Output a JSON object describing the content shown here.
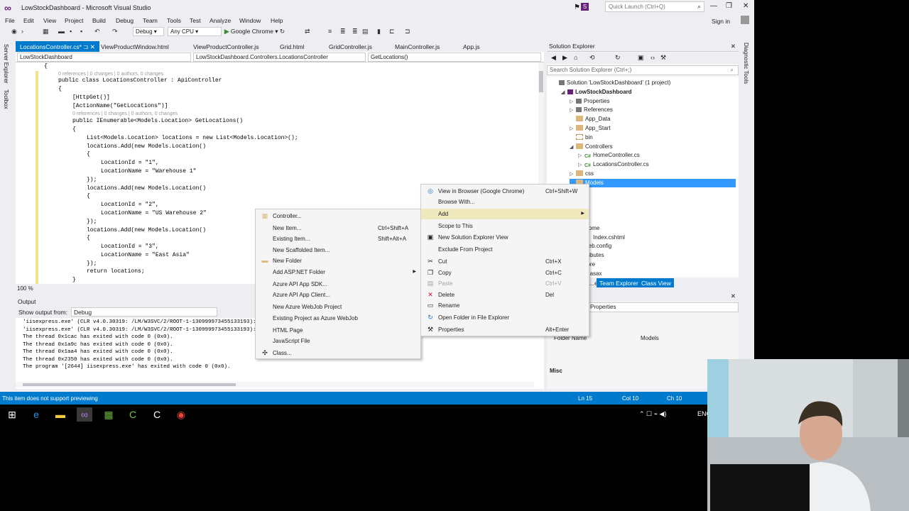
{
  "window": {
    "title": "LowStockDashboard - Microsoft Visual Studio",
    "quick_launch_placeholder": "Quick Launch (Ctrl+Q)",
    "sign_in": "Sign in"
  },
  "menus": [
    "File",
    "Edit",
    "View",
    "Project",
    "Build",
    "Debug",
    "Team",
    "Tools",
    "Test",
    "Analyze",
    "Window",
    "Help"
  ],
  "toolbar": {
    "config": "Debug",
    "platform": "Any CPU",
    "run_target": "Google Chrome"
  },
  "left_tabs": [
    "Server Explorer",
    "Toolbox"
  ],
  "right_tabs": [
    "Diagnostic Tools"
  ],
  "doc_tabs": [
    "LocationsController.cs*",
    "ViewProductWindow.html",
    "ViewProductController.js",
    "Grid.html",
    "GridController.js",
    "MainController.js",
    "App.js"
  ],
  "nav_bar": {
    "project": "LowStockDashboard",
    "class": "LowStockDashboard.Controllers.LocationsController",
    "member": "GetLocations()"
  },
  "code_lines": [
    {
      "indent": 0,
      "text": "{",
      "kind": "code"
    },
    {
      "indent": 1,
      "text": "0 references | 0 changes | 0 authors, 0 changes",
      "kind": "lens"
    },
    {
      "indent": 1,
      "text": "public class LocationsController : ApiController",
      "kind": "code"
    },
    {
      "indent": 1,
      "text": "{",
      "kind": "code"
    },
    {
      "indent": 2,
      "text": "[HttpGet()]",
      "kind": "code"
    },
    {
      "indent": 2,
      "text": "[ActionName(\"GetLocations\")]",
      "kind": "code"
    },
    {
      "indent": 2,
      "text": "0 references | 0 changes | 0 authors, 0 changes",
      "kind": "lens"
    },
    {
      "indent": 2,
      "text": "public IEnumerable<Models.Location> GetLocations()",
      "kind": "code"
    },
    {
      "indent": 2,
      "text": "{",
      "kind": "code"
    },
    {
      "indent": 3,
      "text": "List<Models.Location> locations = new List<Models.Location>();",
      "kind": "code"
    },
    {
      "indent": 3,
      "text": "locations.Add(new Models.Location()",
      "kind": "code"
    },
    {
      "indent": 3,
      "text": "{",
      "kind": "code"
    },
    {
      "indent": 4,
      "text": "LocationId = \"1\",",
      "kind": "code"
    },
    {
      "indent": 4,
      "text": "LocationName = \"Warehouse 1\"",
      "kind": "code"
    },
    {
      "indent": 3,
      "text": "});",
      "kind": "code"
    },
    {
      "indent": 3,
      "text": "locations.Add(new Models.Location()",
      "kind": "code"
    },
    {
      "indent": 3,
      "text": "{",
      "kind": "code"
    },
    {
      "indent": 4,
      "text": "LocationId = \"2\",",
      "kind": "code"
    },
    {
      "indent": 4,
      "text": "LocationName = \"US Warehouse 2\"",
      "kind": "code"
    },
    {
      "indent": 3,
      "text": "});",
      "kind": "code"
    },
    {
      "indent": 3,
      "text": "locations.Add(new Models.Location()",
      "kind": "code"
    },
    {
      "indent": 3,
      "text": "{",
      "kind": "code"
    },
    {
      "indent": 4,
      "text": "LocationId = \"3\",",
      "kind": "code"
    },
    {
      "indent": 4,
      "text": "LocationName = \"East Asia\"",
      "kind": "code"
    },
    {
      "indent": 3,
      "text": "});",
      "kind": "code"
    },
    {
      "indent": 3,
      "text": "return locations;",
      "kind": "code"
    },
    {
      "indent": 2,
      "text": "}",
      "kind": "code"
    }
  ],
  "zoom": "100 %",
  "output": {
    "title": "Output",
    "show_from_label": "Show output from:",
    "source": "Debug",
    "lines": [
      "'iisexpress.exe' (CLR v4.0.30319: /LM/W3SVC/2/ROOT-1-130999973455133193):",
      "'iisexpress.exe' (CLR v4.0.30319: /LM/W3SVC/2/ROOT-1-130999973455133193):",
      "The thread 0x1cac has exited with code 0 (0x0).",
      "The thread 0x1a9c has exited with code 0 (0x0).",
      "The thread 0x1aa4 has exited with code 0 (0x0).",
      "The thread 0x2350 has exited with code 0 (0x0).",
      "The program '[2644] iisexpress.exe' has exited with code 0 (0x0)."
    ]
  },
  "solution_explorer": {
    "title": "Solution Explorer",
    "search_placeholder": "Search Solution Explorer (Ctrl+;)",
    "tree": [
      {
        "label": "Solution 'LowStockDashboard' (1 project)",
        "level": 0,
        "arrow": "",
        "icon": "solution"
      },
      {
        "label": "LowStockDashboard",
        "level": 1,
        "arrow": "◢",
        "icon": "project",
        "bold": true
      },
      {
        "label": "Properties",
        "level": 2,
        "arrow": "▷",
        "icon": "wrench"
      },
      {
        "label": "References",
        "level": 2,
        "arrow": "▷",
        "icon": "refs"
      },
      {
        "label": "App_Data",
        "level": 2,
        "arrow": "",
        "icon": "folder"
      },
      {
        "label": "App_Start",
        "level": 2,
        "arrow": "▷",
        "icon": "folder"
      },
      {
        "label": "bin",
        "level": 2,
        "arrow": "",
        "icon": "folder-hidden"
      },
      {
        "label": "Controllers",
        "level": 2,
        "arrow": "◢",
        "icon": "folder"
      },
      {
        "label": "HomeController.cs",
        "level": 3,
        "arrow": "▷",
        "icon": "cs"
      },
      {
        "label": "LocationsController.cs",
        "level": 3,
        "arrow": "▷",
        "icon": "cs"
      },
      {
        "label": "css",
        "level": 2,
        "arrow": "▷",
        "icon": "folder"
      },
      {
        "label": "Models",
        "level": 2,
        "arrow": "",
        "icon": "folder",
        "selected": true
      },
      {
        "label": "...",
        "level": 2,
        "arrow": "",
        "icon": ""
      },
      {
        "label": "...pts",
        "level": 2,
        "arrow": "",
        "icon": ""
      },
      {
        "label": "...",
        "level": 2,
        "arrow": "",
        "icon": ""
      },
      {
        "label": "...ws",
        "level": 2,
        "arrow": "",
        "icon": ""
      },
      {
        "label": "Home",
        "level": 3,
        "arrow": "",
        "icon": ""
      },
      {
        "label": "Index.cshtml",
        "level": 4,
        "arrow": "",
        "icon": ""
      },
      {
        "label": "web.config",
        "level": 3,
        "arrow": "",
        "icon": ""
      },
      {
        "label": "...attributes",
        "level": 2,
        "arrow": "",
        "icon": ""
      },
      {
        "label": "...gnore",
        "level": 2,
        "arrow": "",
        "icon": ""
      },
      {
        "label": "...bal.asax",
        "level": 2,
        "arrow": "",
        "icon": ""
      }
    ],
    "bottom_tabs": [
      "...er",
      "Team Explorer",
      "Class View"
    ]
  },
  "properties": {
    "title": "Properties",
    "rows": [
      {
        "name": "Folder Name",
        "value": "Models"
      }
    ],
    "section": "Misc"
  },
  "status_bar": {
    "message": "This item does not support previewing",
    "ln": "Ln 15",
    "col": "Col 10",
    "ch": "Ch 10"
  },
  "context_menu_main": [
    {
      "label": "View in Browser (Google Chrome)",
      "shortcut": "Ctrl+Shift+W",
      "icon": "globe-icon"
    },
    {
      "label": "Browse With...",
      "shortcut": "",
      "icon": ""
    },
    {
      "label": "Add",
      "shortcut": "",
      "icon": "",
      "submenu": true,
      "highlight": true
    },
    {
      "label": "Scope to This",
      "shortcut": "",
      "icon": ""
    },
    {
      "label": "New Solution Explorer View",
      "shortcut": "",
      "icon": "new-view-icon"
    },
    {
      "label": "Exclude From Project",
      "shortcut": "",
      "icon": ""
    },
    {
      "label": "Cut",
      "shortcut": "Ctrl+X",
      "icon": "scissors-icon"
    },
    {
      "label": "Copy",
      "shortcut": "Ctrl+C",
      "icon": "copy-icon"
    },
    {
      "label": "Paste",
      "shortcut": "Ctrl+V",
      "icon": "paste-icon",
      "disabled": true
    },
    {
      "label": "Delete",
      "shortcut": "Del",
      "icon": "delete-icon"
    },
    {
      "label": "Rename",
      "shortcut": "",
      "icon": "rename-icon"
    },
    {
      "label": "Open Folder in File Explorer",
      "shortcut": "",
      "icon": "refresh-icon"
    },
    {
      "label": "Properties",
      "shortcut": "Alt+Enter",
      "icon": "wrench-icon"
    }
  ],
  "context_menu_add": [
    {
      "label": "Controller...",
      "shortcut": "",
      "icon": "controller-icon"
    },
    {
      "label": "New Item...",
      "shortcut": "Ctrl+Shift+A",
      "icon": ""
    },
    {
      "label": "Existing Item...",
      "shortcut": "Shift+Alt+A",
      "icon": ""
    },
    {
      "label": "New Scaffolded Item...",
      "shortcut": "",
      "icon": ""
    },
    {
      "label": "New Folder",
      "shortcut": "",
      "icon": "folder-icon"
    },
    {
      "label": "Add ASP.NET Folder",
      "shortcut": "",
      "icon": "",
      "submenu": true
    },
    {
      "label": "Azure API App SDK...",
      "shortcut": "",
      "icon": ""
    },
    {
      "label": "Azure API App Client...",
      "shortcut": "",
      "icon": ""
    },
    {
      "label": "New Azure WebJob Project",
      "shortcut": "",
      "icon": ""
    },
    {
      "label": "Existing Project as Azure WebJob",
      "shortcut": "",
      "icon": ""
    },
    {
      "label": "HTML Page",
      "shortcut": "",
      "icon": ""
    },
    {
      "label": "JavaScript File",
      "shortcut": "",
      "icon": ""
    },
    {
      "label": "Class...",
      "shortcut": "",
      "icon": "class-icon"
    }
  ],
  "taskbar": {
    "lang": "ENG"
  },
  "colors": {
    "accent": "#007acc",
    "vs_purple": "#68217a",
    "selection": "#3399ff",
    "menu_highlight": "#f0e9bd"
  }
}
